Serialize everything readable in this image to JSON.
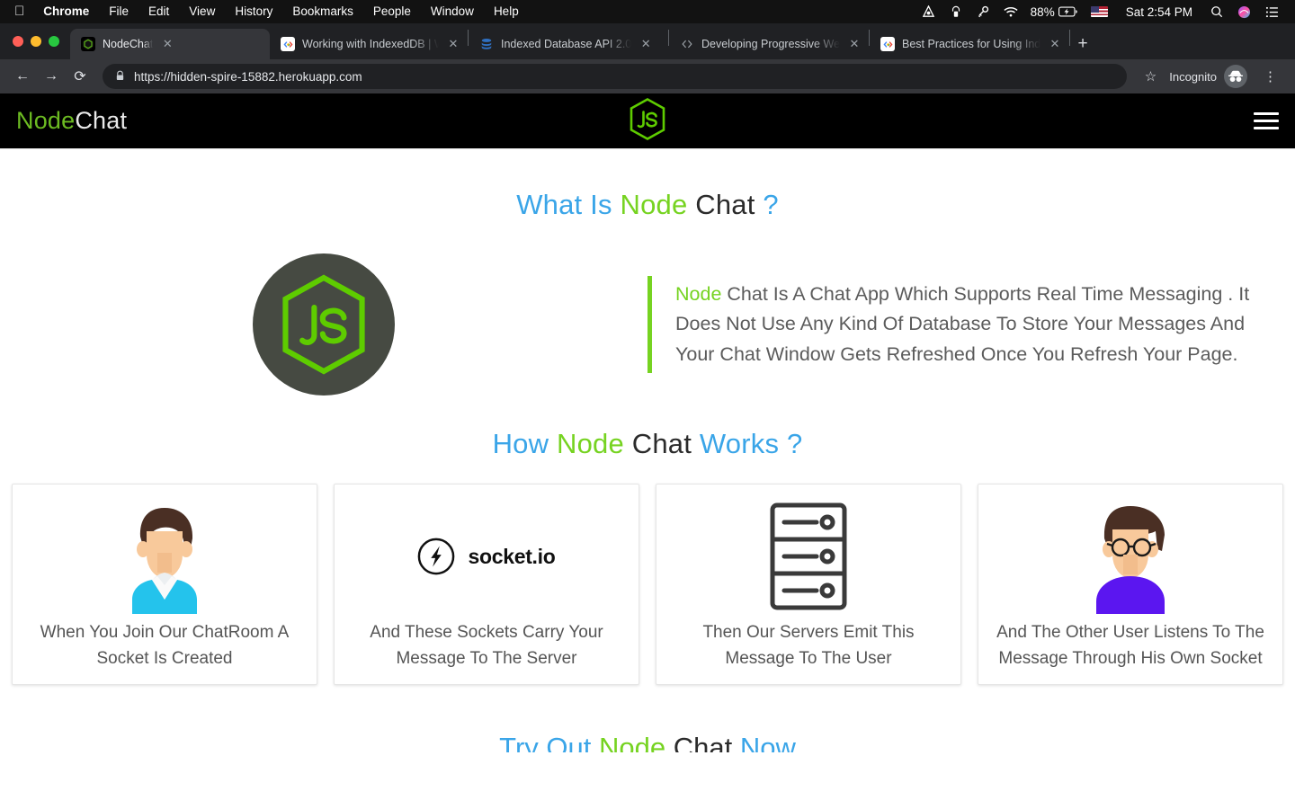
{
  "menubar": {
    "apple": "",
    "items": [
      {
        "label": "Chrome",
        "bold": true
      },
      {
        "label": "File",
        "bold": false
      },
      {
        "label": "Edit",
        "bold": false
      },
      {
        "label": "View",
        "bold": false
      },
      {
        "label": "History",
        "bold": false
      },
      {
        "label": "Bookmarks",
        "bold": false
      },
      {
        "label": "People",
        "bold": false
      },
      {
        "label": "Window",
        "bold": false
      },
      {
        "label": "Help",
        "bold": false
      }
    ],
    "status": {
      "avast_icon": "avast-icon",
      "vpn_icon": "vpn-lock-icon",
      "key_icon": "key-icon",
      "wifi_icon": "wifi-icon",
      "battery_percent": "88%",
      "battery_icon": "battery-charging-icon",
      "input_flag": "us-flag-icon",
      "clock": "Sat 2:54 PM",
      "search_icon": "spotlight-search-icon",
      "siri_icon": "siri-icon",
      "control_center_icon": "control-center-icon"
    }
  },
  "browser": {
    "tabs": [
      {
        "title": "NodeChat",
        "favicon": "nodechat-favicon",
        "active": true
      },
      {
        "title": "Working with IndexedDB  |  We",
        "favicon": "google-developers-favicon",
        "active": false
      },
      {
        "title": "Indexed Database API 2.0",
        "favicon": "w3c-database-favicon",
        "active": false
      },
      {
        "title": "Developing Progressive Web A",
        "favicon": "code-brackets-favicon",
        "active": false
      },
      {
        "title": "Best Practices for Using Indexe",
        "favicon": "google-developers-favicon",
        "active": false
      }
    ],
    "new_tab_label": "+",
    "nav": {
      "back": "←",
      "forward": "→",
      "reload": "⟳"
    },
    "url": "https://hidden-spire-15882.herokuapp.com",
    "lock_icon": "lock-icon",
    "bookmark_icon": "star-icon",
    "incognito_label": "Incognito",
    "menu_icon": "three-dot-menu-icon"
  },
  "site": {
    "brand": {
      "first": "Node",
      "second": "Chat"
    },
    "logo_alt": "nodejs-logo",
    "menu_toggle": "hamburger-menu-icon",
    "about": {
      "title": {
        "p1": "What Is ",
        "p2": "Node ",
        "p3": "Chat ",
        "p4": "?"
      },
      "quote_highlight": "Node",
      "quote_body": " Chat Is A Chat App Which Supports Real Time Messaging . It Does Not Use Any Kind Of Database To Store Your Messages And Your Chat Window Gets Refreshed Once You Refresh Your Page."
    },
    "how": {
      "title": {
        "p1": "How ",
        "p2": "Node ",
        "p3": "Chat ",
        "p4": "Works ?"
      },
      "cards": [
        {
          "icon": "user-avatar-blue-shirt-icon",
          "text": "When You Join Our ChatRoom A Socket Is Created"
        },
        {
          "icon": "socketio-logo-icon",
          "text": "And These Sockets Carry Your Message To The Server",
          "logo_text": "socket.io"
        },
        {
          "icon": "server-rack-icon",
          "text": "Then Our Servers Emit This Message To The User"
        },
        {
          "icon": "user-avatar-glasses-purple-shirt-icon",
          "text": "And The Other User Listens To The Message Through His Own Socket"
        }
      ]
    },
    "tryout": {
      "title": {
        "p1": "Try ",
        "p2": "Out ",
        "p3": "Node ",
        "p4": "Chat ",
        "p5": "Now"
      }
    },
    "colors": {
      "blue": "#3aa5e8",
      "green": "#76d321",
      "dark": "#2b2b2b",
      "header_bg": "#000000",
      "logo_circle": "#464a42"
    }
  }
}
